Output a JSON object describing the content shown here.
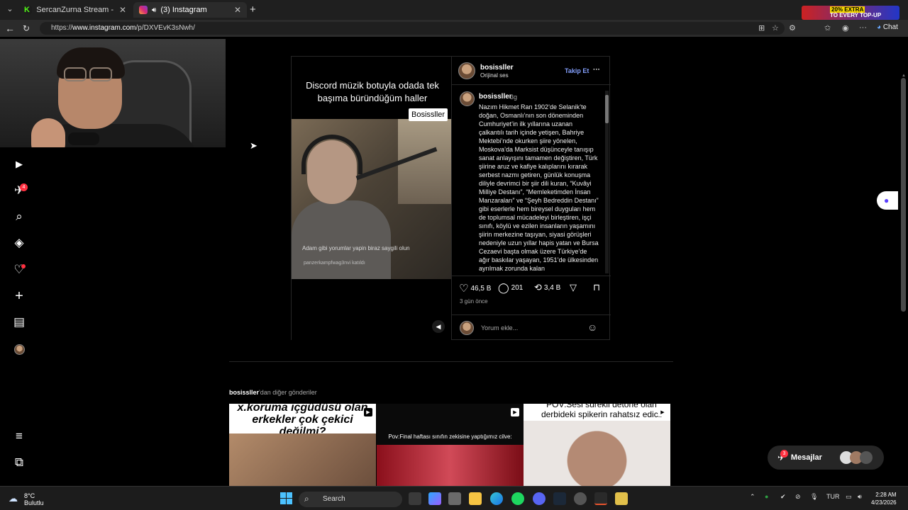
{
  "browser": {
    "tabs": [
      {
        "title": "SercanZurna Stream - Watch Live",
        "active": false
      },
      {
        "title": "(3) Instagram",
        "active": true
      }
    ],
    "url_prefix": "https://",
    "url_host": "www.instagram.com",
    "url_path": "/p/DXVEvK3sNwh/",
    "promo_line1": "20% EXTRA",
    "promo_line2": "TO EVERY TOP-UP",
    "chat_label": "Chat"
  },
  "sidebar": {
    "items": [
      {
        "name": "instagram-logo-icon",
        "glyph": "◎"
      },
      {
        "name": "home-icon",
        "glyph": "⌂"
      },
      {
        "name": "reels-icon",
        "glyph": "▶"
      },
      {
        "name": "messages-icon",
        "glyph": "✈",
        "badge": "4"
      },
      {
        "name": "search-icon",
        "glyph": "⌕"
      },
      {
        "name": "explore-icon",
        "glyph": "◈"
      },
      {
        "name": "notifications-icon",
        "glyph": "♡"
      },
      {
        "name": "create-icon",
        "glyph": "+"
      },
      {
        "name": "dashboard-icon",
        "glyph": "▤"
      },
      {
        "name": "profile-avatar",
        "glyph": ""
      },
      {
        "name": "more-menu-icon",
        "glyph": "≡"
      },
      {
        "name": "also-from-meta-icon",
        "glyph": "⧉"
      }
    ]
  },
  "post": {
    "video_caption": "Discord müzik botuyla odada tek başıma büründüğüm haller",
    "video_label": "Bosissller",
    "video_sub1": "Adam gibi yorumlar yapin biraz saygili olun",
    "video_sub2": "panzerkampfwag3nvi katıldı",
    "author": "bosissller",
    "audio": "Orijinal ses",
    "follow": "Takip Et",
    "more": "···",
    "comment_author": "bosissller",
    "comment_age": "3g",
    "caption": "Nazım Hikmet Ran 1902’de Selanik’te doğan, Osmanlı’nın son döneminden Cumhuriyet’in ilk yıllarına uzanan çalkantılı tarih içinde yetişen, Bahriye Mektebi’nde okurken şiire yönelen, Moskova’da Marksist düşünceyle tanışıp sanat anlayışını tamamen değiştiren, Türk şiirine aruz ve kafiye kalıplarını kırarak serbest nazmı getiren, günlük konuşma diliyle devrimci bir şiir dili kuran, “Kuvâyi Milliye Destanı”, “Memleketimden İnsan Manzaraları” ve “Şeyh Bedreddin Destanı” gibi eserlerle hem bireysel duyguları hem de toplumsal mücadeleyi birleştiren, işçi sınıfı, köylü ve ezilen insanların yaşamını şiirin merkezine taşıyan, siyasi görüşleri nedeniyle uzun yıllar hapis yatan ve Bursa Cezaevi başta olmak üzere Türkiye’de ağır baskılar yaşayan, 1951’de ülkesinden ayrılmak zorunda kalan",
    "likes": "46,5 B",
    "comments": "201",
    "reposts": "3,4 B",
    "date": "3 gün önce",
    "comment_placeholder": "Yorum ekle..."
  },
  "more_posts": {
    "title_user": "bosissller",
    "title_rest": "'dan diğer gönderiler",
    "thumbs": [
      {
        "text": "x.koruma içgüdüsü olan erkekler çok çekici değilmi?"
      },
      {
        "text": "Pov:Final haftası sınıfın zekisine yaptığımız cilve:"
      },
      {
        "text": "POV:Sesi sürekli detone olan derbideki spikerin rahatsız edicil"
      }
    ]
  },
  "messages": {
    "label": "Mesajlar",
    "badge": "3"
  },
  "taskbar": {
    "temp": "8°C",
    "weather": "Bulutlu",
    "search": "Search",
    "lang": "TUR",
    "time": "2:28 AM",
    "date": "4/23/2026"
  }
}
